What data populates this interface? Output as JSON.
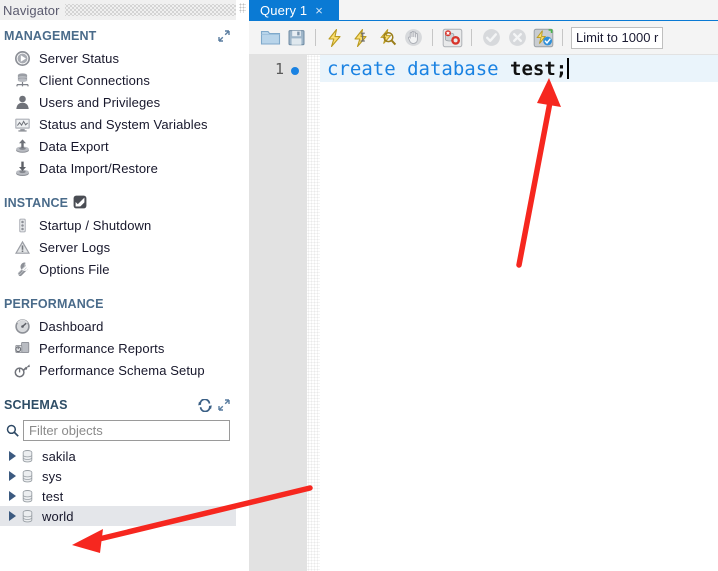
{
  "navigator": {
    "title": "Navigator",
    "sections": [
      {
        "name": "management",
        "title": "MANAGEMENT",
        "header_icons": [
          "expand-icon"
        ],
        "items": [
          {
            "label": "Server Status",
            "icon": "server-status-icon"
          },
          {
            "label": "Client Connections",
            "icon": "client-connections-icon"
          },
          {
            "label": "Users and Privileges",
            "icon": "users-privileges-icon"
          },
          {
            "label": "Status and System Variables",
            "icon": "status-variables-icon"
          },
          {
            "label": "Data Export",
            "icon": "data-export-icon"
          },
          {
            "label": "Data Import/Restore",
            "icon": "data-import-icon"
          }
        ]
      },
      {
        "name": "instance",
        "title": "INSTANCE",
        "header_icons": [
          "instance-badge-icon"
        ],
        "items": [
          {
            "label": "Startup / Shutdown",
            "icon": "startup-shutdown-icon"
          },
          {
            "label": "Server Logs",
            "icon": "server-logs-icon"
          },
          {
            "label": "Options File",
            "icon": "options-file-icon"
          }
        ]
      },
      {
        "name": "performance",
        "title": "PERFORMANCE",
        "header_icons": [],
        "items": [
          {
            "label": "Dashboard",
            "icon": "dashboard-icon"
          },
          {
            "label": "Performance Reports",
            "icon": "performance-reports-icon"
          },
          {
            "label": "Performance Schema Setup",
            "icon": "performance-schema-icon"
          }
        ]
      }
    ],
    "schemas": {
      "title": "SCHEMAS",
      "header_icons": [
        "refresh-icon",
        "expand-icon"
      ],
      "filter": {
        "placeholder": "Filter objects",
        "value": "",
        "icon": "search-icon"
      },
      "items": [
        {
          "label": "sakila",
          "selected": false
        },
        {
          "label": "sys",
          "selected": false
        },
        {
          "label": "test",
          "selected": false
        },
        {
          "label": "world",
          "selected": true
        }
      ]
    }
  },
  "editor": {
    "tabs": [
      {
        "label": "Query 1",
        "close": "×",
        "active": true
      }
    ],
    "toolbar": {
      "buttons": [
        {
          "name": "open-script-icon",
          "title": "Open a script file in this editor"
        },
        {
          "name": "save-script-icon",
          "title": "Save this script file"
        },
        {
          "name": "execute-statement-icon",
          "title": "Execute the selected portion of the script"
        },
        {
          "name": "execute-current-statement-icon",
          "title": "Execute the statement under the keyboard cursor"
        },
        {
          "name": "explain-statement-icon",
          "title": "Execute the EXPLAIN command on the statement"
        },
        {
          "name": "stop-execution-icon",
          "title": "Stop the query being executed"
        },
        {
          "name": "toggle-stop-on-error-icon",
          "title": "Toggle whether execution should stop on errors"
        },
        {
          "name": "commit-icon",
          "title": "Commit the current transaction"
        },
        {
          "name": "rollback-icon",
          "title": "Rollback the current transaction"
        },
        {
          "name": "autocommit-icon",
          "title": "Toggle autocommit mode"
        }
      ],
      "limit_label": "Limit to 1000 r"
    },
    "gutter": {
      "line_number": "1",
      "marker": "breakpoint-dot"
    },
    "code": {
      "keyword_part": "create database ",
      "identifier_part": "test;",
      "full_text": "create database test;"
    }
  },
  "annotations": [
    {
      "name": "arrow-to-sql-statement",
      "color": "#f6271f",
      "direction": "up"
    },
    {
      "name": "arrow-to-test-schema",
      "color": "#f6271f",
      "direction": "down-left"
    }
  ],
  "colors": {
    "tab_active": "#0a7ad4",
    "keyword": "#1a82e2",
    "identifier": "#111111",
    "code_line_highlight": "#eaf4fb",
    "gutter": "#e2e2e2",
    "section_title": "#4a6b8a",
    "annotation_red": "#f6271f",
    "tree_selected": "#e4e6ea"
  }
}
